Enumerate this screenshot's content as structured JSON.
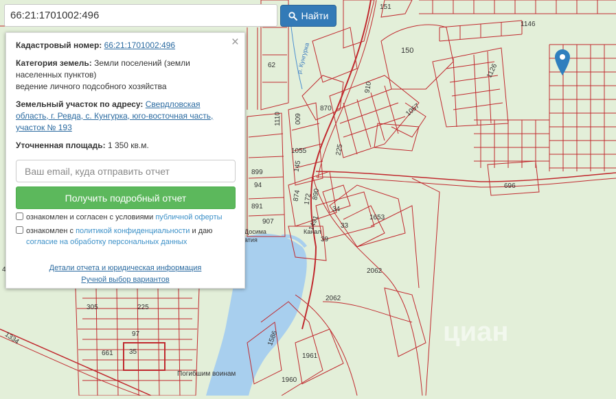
{
  "search": {
    "value": "66:21:1701002:496",
    "button_label": "Найти"
  },
  "info": {
    "cadastral_label": "Кадастровый номер:",
    "cadastral_number": "66:21:1701002:496",
    "category_label": "Категория земель:",
    "category_value": "Земли поселений (земли населенных пунктов)",
    "usage": "ведение личного подсобного хозяйства",
    "address_label": "Земельный участок по адресу:",
    "address_value": "Свердловская область, г. Ревда, с. Кунгурка, юго-восточная часть, участок № 193",
    "area_label": "Уточненная площадь:",
    "area_value": "1 350 кв.м."
  },
  "form": {
    "email_placeholder": "Ваш email, куда отправить отчет",
    "submit_label": "Получить подробный отчет",
    "consent1_text": "ознакомлен и согласен с условиями",
    "consent1_link": "публичной оферты",
    "consent2_text": "ознакомлен с",
    "consent2_link": "политикой конфиденциальности",
    "consent2_text2": "и даю",
    "consent2_link2": "согласие на обработку персональных данных"
  },
  "links": {
    "details": "Детали отчета и юридическая информация",
    "manual": "Ручной выбор вариантов"
  },
  "map": {
    "parcel_labels": [
      "151",
      "1146",
      "150",
      "62",
      "1126",
      "910",
      "870",
      "1057",
      "1110",
      "009",
      "1055",
      "145",
      "225",
      "899",
      "94",
      "874",
      "172",
      "890",
      "34",
      "1653",
      "891",
      "907",
      "1491",
      "33",
      "39",
      "696",
      "2062",
      "2062",
      "1586",
      "1961",
      "1960",
      "305",
      "225",
      "97",
      "661",
      "35",
      "4",
      "1334"
    ],
    "text_labels": [
      "р. Кунгурка",
      "Погибшим воинам",
      "Досима",
      "атия",
      "Канал"
    ],
    "watermark": "циан"
  },
  "colors": {
    "map_bg": "#e3efd9",
    "parcel_line": "#c0282d",
    "water": "#a8cfee",
    "primary_button": "#337ab7",
    "success_button": "#5cb85c",
    "marker": "#2e7fbe"
  }
}
